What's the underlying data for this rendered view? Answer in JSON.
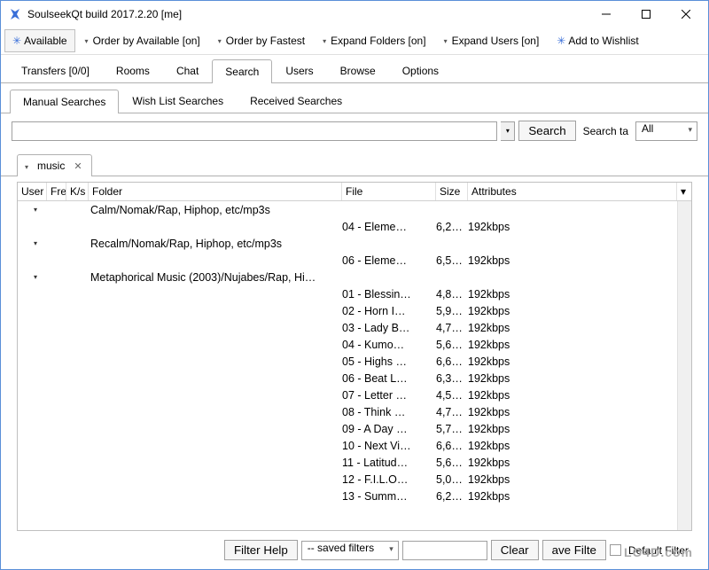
{
  "window": {
    "title": "SoulseekQt build 2017.2.20 [me]"
  },
  "toolbar": {
    "available": "Available",
    "order_available": "Order by Available [on]",
    "order_fastest": "Order by Fastest",
    "expand_folders": "Expand Folders [on]",
    "expand_users": "Expand Users [on]",
    "add_wishlist": "Add to Wishlist"
  },
  "main_tabs": [
    "Transfers [0/0]",
    "Rooms",
    "Chat",
    "Search",
    "Users",
    "Browse",
    "Options"
  ],
  "main_tab_active": 3,
  "sub_tabs": [
    "Manual Searches",
    "Wish List Searches",
    "Received Searches"
  ],
  "sub_tab_active": 0,
  "search": {
    "value": "",
    "button": "Search",
    "target_label": "Search ta",
    "target_value": "All"
  },
  "result_tab": {
    "label": "music"
  },
  "columns": {
    "user": "User",
    "free": "Fre",
    "ks": "K/s",
    "folder": "Folder",
    "file": "File",
    "size": "Size",
    "attr": "Attributes"
  },
  "rows": [
    {
      "chev": true,
      "folder": "Calm/Nomak/Rap, Hiphop, etc/mp3s",
      "file": "",
      "size": "",
      "attr": ""
    },
    {
      "chev": false,
      "folder": "",
      "file": "04 - Eleme…",
      "size": "6,2…",
      "attr": "192kbps"
    },
    {
      "chev": true,
      "folder": "Recalm/Nomak/Rap, Hiphop, etc/mp3s",
      "file": "",
      "size": "",
      "attr": ""
    },
    {
      "chev": false,
      "folder": "",
      "file": "06 - Eleme…",
      "size": "6,5…",
      "attr": "192kbps"
    },
    {
      "chev": true,
      "folder": "Metaphorical Music (2003)/Nujabes/Rap, Hi…",
      "file": "",
      "size": "",
      "attr": ""
    },
    {
      "chev": false,
      "folder": "",
      "file": "01 - Blessin…",
      "size": "4,8…",
      "attr": "192kbps"
    },
    {
      "chev": false,
      "folder": "",
      "file": "02 - Horn I…",
      "size": "5,9…",
      "attr": "192kbps"
    },
    {
      "chev": false,
      "folder": "",
      "file": "03 - Lady B…",
      "size": "4,7…",
      "attr": "192kbps"
    },
    {
      "chev": false,
      "folder": "",
      "file": "04 - Kumo…",
      "size": "5,6…",
      "attr": "192kbps"
    },
    {
      "chev": false,
      "folder": "",
      "file": "05 - Highs …",
      "size": "6,6…",
      "attr": "192kbps"
    },
    {
      "chev": false,
      "folder": "",
      "file": "06 - Beat L…",
      "size": "6,3…",
      "attr": "192kbps"
    },
    {
      "chev": false,
      "folder": "",
      "file": "07 - Letter …",
      "size": "4,5…",
      "attr": "192kbps"
    },
    {
      "chev": false,
      "folder": "",
      "file": "08 - Think …",
      "size": "4,7…",
      "attr": "192kbps"
    },
    {
      "chev": false,
      "folder": "",
      "file": "09 - A Day …",
      "size": "5,7…",
      "attr": "192kbps"
    },
    {
      "chev": false,
      "folder": "",
      "file": "10 - Next Vi…",
      "size": "6,6…",
      "attr": "192kbps"
    },
    {
      "chev": false,
      "folder": "",
      "file": "11 - Latitud…",
      "size": "5,6…",
      "attr": "192kbps"
    },
    {
      "chev": false,
      "folder": "",
      "file": "12 - F.I.L.O…",
      "size": "5,0…",
      "attr": "192kbps"
    },
    {
      "chev": false,
      "folder": "",
      "file": "13 - Summ…",
      "size": "6,2…",
      "attr": "192kbps"
    }
  ],
  "footer": {
    "filter_help": "Filter Help",
    "saved_filters": "-- saved filters",
    "filter_value": "",
    "clear": "Clear",
    "save_filter": "ave Filte",
    "default_filter": "Default Filter"
  },
  "watermark": "LO4D.com"
}
